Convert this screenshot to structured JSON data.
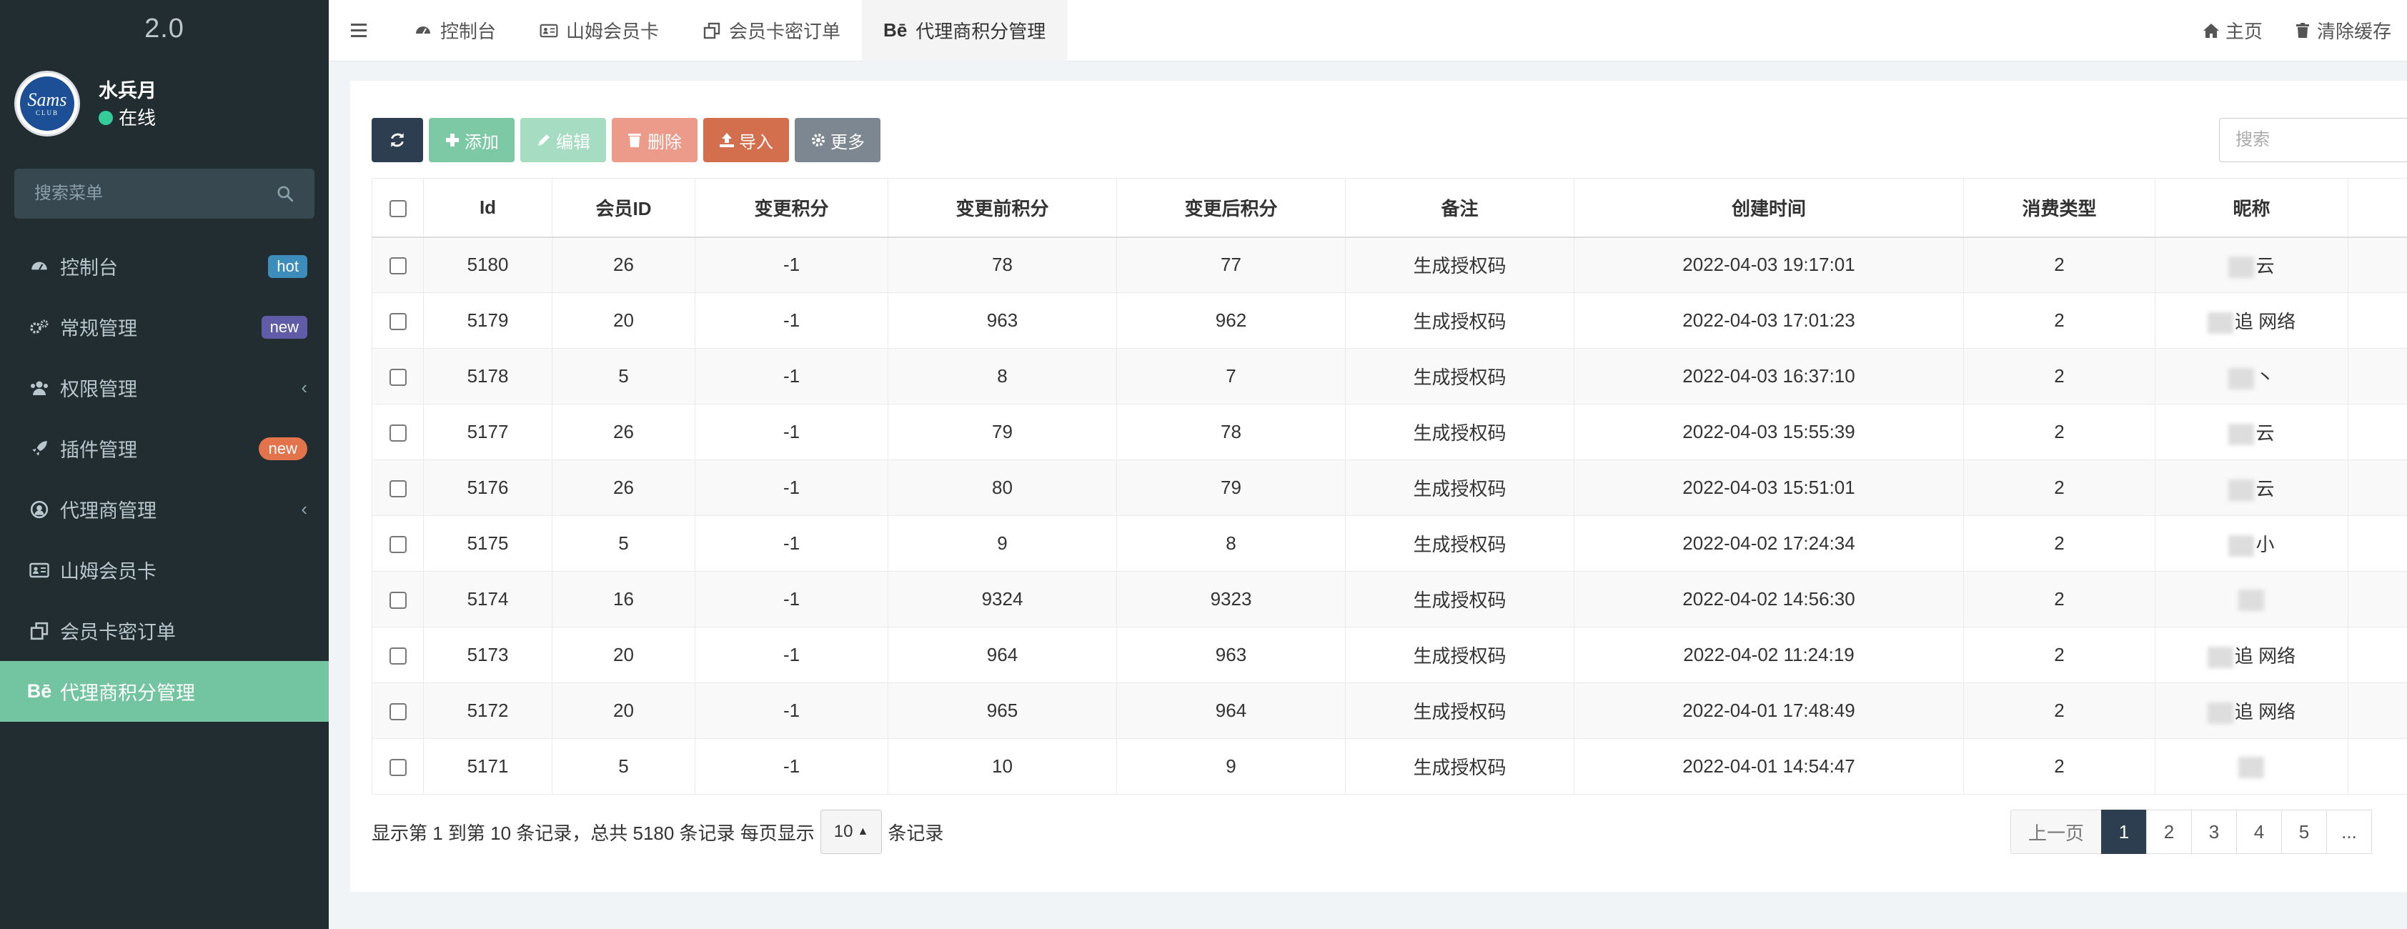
{
  "app": {
    "version": "2.0"
  },
  "user": {
    "name": "水兵月",
    "status": "在线",
    "avatar_text": "Sams",
    "avatar_subtext": "CLUB"
  },
  "sidebar": {
    "search_placeholder": "搜索菜单",
    "items": [
      {
        "label": "控制台",
        "icon": "dashboard-icon",
        "badge": "hot"
      },
      {
        "label": "常规管理",
        "icon": "cogs-icon",
        "badge": "new"
      },
      {
        "label": "权限管理",
        "icon": "group-icon"
      },
      {
        "label": "插件管理",
        "icon": "rocket-icon",
        "badge": "new"
      },
      {
        "label": "代理商管理",
        "icon": "user-circle-icon"
      },
      {
        "label": "山姆会员卡",
        "icon": "id-card-icon"
      },
      {
        "label": "会员卡密订单",
        "icon": "clone-icon"
      },
      {
        "label": "代理商积分管理",
        "icon": "behance-icon",
        "icon_text": "Bē"
      }
    ]
  },
  "topbar": {
    "tabs": [
      {
        "label": "控制台",
        "icon": "dashboard-icon"
      },
      {
        "label": "山姆会员卡",
        "icon": "id-card-icon"
      },
      {
        "label": "会员卡密订单",
        "icon": "clone-icon"
      },
      {
        "label": "代理商积分管理",
        "icon": "behance-icon",
        "icon_text": "Bē"
      }
    ],
    "home_label": "主页",
    "clear_cache_label": "清除缓存"
  },
  "toolbar": {
    "add_label": "添加",
    "edit_label": "编辑",
    "delete_label": "删除",
    "import_label": "导入",
    "more_label": "更多",
    "search_placeholder": "搜索"
  },
  "table": {
    "columns": [
      "Id",
      "会员ID",
      "变更积分",
      "变更前积分",
      "变更后积分",
      "备注",
      "创建时间",
      "消费类型",
      "昵称"
    ],
    "rows": [
      {
        "id": "5180",
        "member_id": "26",
        "change": "-1",
        "before": "78",
        "after": "77",
        "remark": "生成授权码",
        "created": "2022-04-03 19:17:01",
        "type": "2",
        "nick": "云"
      },
      {
        "id": "5179",
        "member_id": "20",
        "change": "-1",
        "before": "963",
        "after": "962",
        "remark": "生成授权码",
        "created": "2022-04-03 17:01:23",
        "type": "2",
        "nick": "追 网络"
      },
      {
        "id": "5178",
        "member_id": "5",
        "change": "-1",
        "before": "8",
        "after": "7",
        "remark": "生成授权码",
        "created": "2022-04-03 16:37:10",
        "type": "2",
        "nick": "丶"
      },
      {
        "id": "5177",
        "member_id": "26",
        "change": "-1",
        "before": "79",
        "after": "78",
        "remark": "生成授权码",
        "created": "2022-04-03 15:55:39",
        "type": "2",
        "nick": "云"
      },
      {
        "id": "5176",
        "member_id": "26",
        "change": "-1",
        "before": "80",
        "after": "79",
        "remark": "生成授权码",
        "created": "2022-04-03 15:51:01",
        "type": "2",
        "nick": "云"
      },
      {
        "id": "5175",
        "member_id": "5",
        "change": "-1",
        "before": "9",
        "after": "8",
        "remark": "生成授权码",
        "created": "2022-04-02 17:24:34",
        "type": "2",
        "nick": "小"
      },
      {
        "id": "5174",
        "member_id": "16",
        "change": "-1",
        "before": "9324",
        "after": "9323",
        "remark": "生成授权码",
        "created": "2022-04-02 14:56:30",
        "type": "2",
        "nick": ""
      },
      {
        "id": "5173",
        "member_id": "20",
        "change": "-1",
        "before": "964",
        "after": "963",
        "remark": "生成授权码",
        "created": "2022-04-02 11:24:19",
        "type": "2",
        "nick": "追 网络"
      },
      {
        "id": "5172",
        "member_id": "20",
        "change": "-1",
        "before": "965",
        "after": "964",
        "remark": "生成授权码",
        "created": "2022-04-01 17:48:49",
        "type": "2",
        "nick": "追 网络"
      },
      {
        "id": "5171",
        "member_id": "5",
        "change": "-1",
        "before": "10",
        "after": "9",
        "remark": "生成授权码",
        "created": "2022-04-01 14:54:47",
        "type": "2",
        "nick": ""
      }
    ]
  },
  "footer": {
    "summary": "显示第 1 到第 10 条记录，总共 5180 条记录 每页显示",
    "page_size": "10",
    "page_size_suffix": "条记录",
    "prev_label": "上一页",
    "pages": [
      "1",
      "2",
      "3",
      "4",
      "5",
      "..."
    ],
    "current_page": "1"
  },
  "colors": {
    "sidebar_bg": "#222d32",
    "active_menu": "#73c4a0",
    "accent_dark": "#2c3e50",
    "add": "#7dc8a5",
    "import": "#d46f4d",
    "delete": "#ec9a8a"
  }
}
